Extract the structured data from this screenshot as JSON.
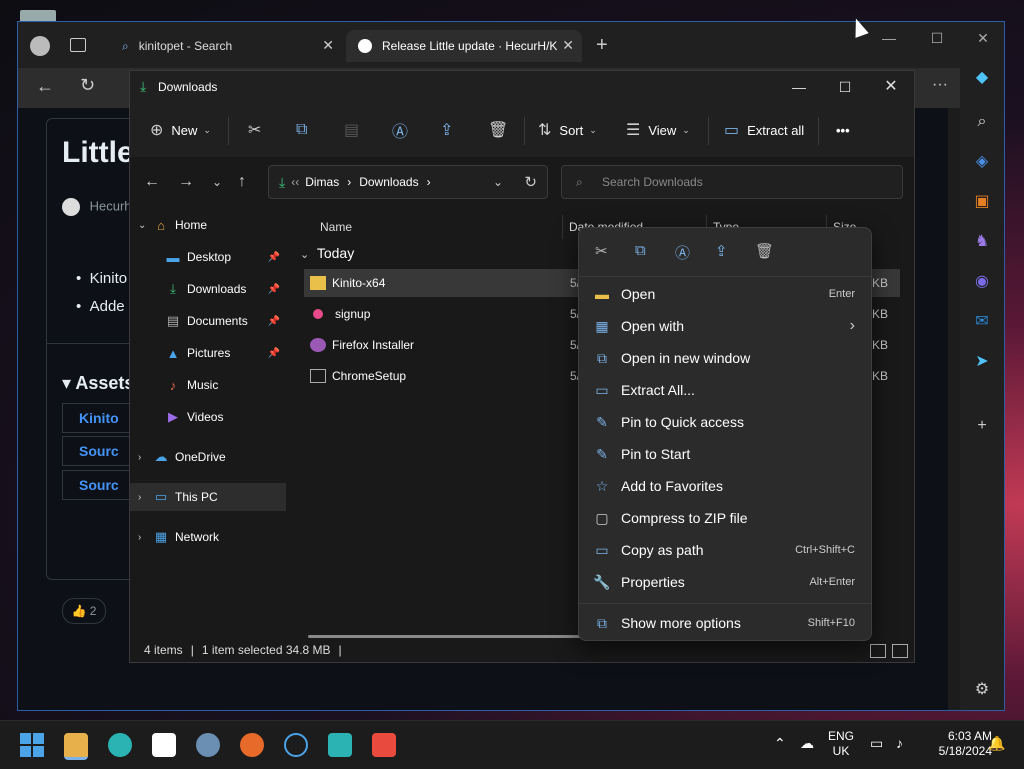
{
  "edge": {
    "tabs": [
      {
        "label": "kinitopet - Search",
        "close": "✕"
      },
      {
        "label": "Release Little update · HecurH/K",
        "close": "✕"
      }
    ],
    "new_tab": "+",
    "window_controls": {
      "minimize": "—",
      "maximize": "☐",
      "close": "✕"
    },
    "more": "···",
    "page": {
      "title": "Little",
      "author": "Hecurh",
      "bullets": [
        "Kinito",
        "Adde"
      ],
      "assets_heading": "Assets",
      "assets": [
        "Kinito",
        "Sourc",
        "Sourc"
      ],
      "reaction_count": "2"
    }
  },
  "explorer": {
    "title": "Downloads",
    "window_controls": {
      "minimize": "—",
      "maximize": "☐",
      "close": "✕"
    },
    "toolbar": {
      "new": "New",
      "sort": "Sort",
      "view": "View",
      "extract_all": "Extract all",
      "more": "•••"
    },
    "address": {
      "prefix": "‹‹",
      "parts": [
        "Dimas",
        "Downloads"
      ]
    },
    "search_placeholder": "Search Downloads",
    "nav": {
      "home": "Home",
      "quick": [
        "Desktop",
        "Downloads",
        "Documents",
        "Pictures",
        "Music",
        "Videos"
      ],
      "onedrive": "OneDrive",
      "this_pc": "This PC",
      "network": "Network"
    },
    "columns": {
      "name": "Name",
      "date": "Date modified",
      "type": "Type",
      "size": "Size"
    },
    "group": "Today",
    "files": [
      {
        "name": "Kinito-x64",
        "date": "5/",
        "size": "07 KB"
      },
      {
        "name": "signup",
        "date": "5/",
        "size": "36 KB"
      },
      {
        "name": "Firefox Installer",
        "date": "5/",
        "size": "42 KB"
      },
      {
        "name": "ChromeSetup",
        "date": "5/",
        "size": "75 KB"
      }
    ],
    "status": {
      "items": "4 items",
      "selected": "1 item selected  34.8 MB"
    }
  },
  "context_menu": {
    "items": [
      {
        "label": "Open",
        "shortcut": "Enter"
      },
      {
        "label": "Open with",
        "shortcut": "›"
      },
      {
        "label": "Open in new window",
        "shortcut": ""
      },
      {
        "label": "Extract All...",
        "shortcut": ""
      },
      {
        "label": "Pin to Quick access",
        "shortcut": ""
      },
      {
        "label": "Pin to Start",
        "shortcut": ""
      },
      {
        "label": "Add to Favorites",
        "shortcut": ""
      },
      {
        "label": "Compress to ZIP file",
        "shortcut": ""
      },
      {
        "label": "Copy as path",
        "shortcut": "Ctrl+Shift+C"
      },
      {
        "label": "Properties",
        "shortcut": "Alt+Enter"
      },
      {
        "label": "Show more options",
        "shortcut": "Shift+F10"
      }
    ]
  },
  "taskbar": {
    "lang": "ENG",
    "region": "UK",
    "time": "6:03 AM",
    "date": "5/18/2024"
  }
}
